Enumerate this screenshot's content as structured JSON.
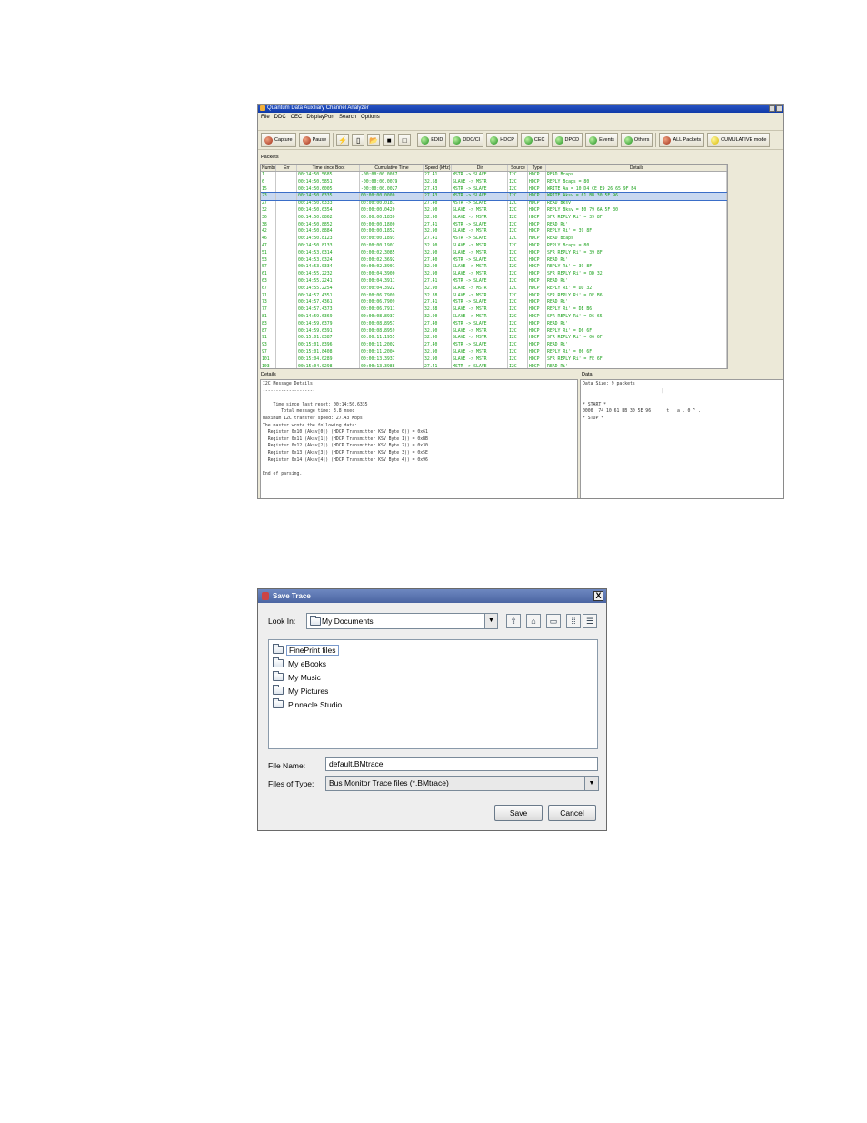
{
  "analyzer": {
    "title": "Quantum Data Auxiliary Channel Analyzer",
    "menu": [
      "File",
      "DDC",
      "CEC",
      "DisplayPort",
      "Search",
      "Options"
    ],
    "toolbar": {
      "capture": "Capture",
      "pause": "Pause",
      "edid": "EDID",
      "ddcci": "DDC/CI",
      "hdcp": "HDCP",
      "cec": "CEC",
      "dpcd": "DPCD",
      "events": "Events",
      "others": "Others",
      "all_packets": "ALL Packets",
      "cumulative": "CUMULATIVE mode"
    },
    "packets_label": "Packets",
    "columns": [
      "Number",
      "Err",
      "Time since Boot",
      "Cumulative Time",
      "Speed (kHz)",
      "Dir",
      "Source",
      "Type",
      "Details"
    ],
    "rows": [
      [
        "1",
        "",
        "00:14:50.5685",
        "-00:00:00.0087",
        "27.41",
        "MSTR -> SLAVE",
        "I2C",
        "HDCP",
        "READ Bcaps"
      ],
      [
        "6",
        "",
        "00:14:50.5851",
        "-00:00:00.0079",
        "32.68",
        "SLAVE -> MSTR",
        "I2C",
        "HDCP",
        "REPLY Bcaps = 80"
      ],
      [
        "15",
        "",
        "00:14:50.6005",
        "-00:00:00.0027",
        "27.43",
        "MSTR -> SLAVE",
        "I2C",
        "HDCP",
        "WRITE Aa = 10 D4 CE E9 26 65 9F B4"
      ],
      [
        "23",
        "",
        "00:14:50.6335",
        "00:00:00.0000",
        "27.43",
        "MSTR -> SLAVE",
        "I2C",
        "HDCP",
        "WRITE Aksv = 61 BB 30 5E 96"
      ],
      [
        "27",
        "",
        "00:14:50.6333",
        "00:00:00.0181",
        "27.40",
        "MSTR -> SLAVE",
        "I2C",
        "HDCP",
        "READ Bksv"
      ],
      [
        "32",
        "",
        "00:14:50.6354",
        "00:00:00.0420",
        "32.90",
        "SLAVE -> MSTR",
        "I2C",
        "HDCP",
        "REPLY Bksv = E0 79 6A 5F 30"
      ],
      [
        "36",
        "",
        "00:14:50.8862",
        "00:00:00.1830",
        "32.90",
        "SLAVE -> MSTR",
        "I2C",
        "HDCP",
        "SFR REPLY Ri' = 39 8F"
      ],
      [
        "38",
        "",
        "00:14:50.8852",
        "00:00:00.1800",
        "27.41",
        "MSTR -> SLAVE",
        "I2C",
        "HDCP",
        "READ Ri'"
      ],
      [
        "42",
        "",
        "00:14:50.8884",
        "00:00:00.1852",
        "32.90",
        "SLAVE -> MSTR",
        "I2C",
        "HDCP",
        "REPLY Ri' = 39 8F"
      ],
      [
        "46",
        "",
        "00:14:50.8123",
        "00:00:00.1893",
        "27.41",
        "MSTR -> SLAVE",
        "I2C",
        "HDCP",
        "READ Bcaps"
      ],
      [
        "47",
        "",
        "00:14:50.8133",
        "00:00:00.1901",
        "32.90",
        "SLAVE -> MSTR",
        "I2C",
        "HDCP",
        "REPLY Bcaps = 80"
      ],
      [
        "51",
        "",
        "00:14:53.0314",
        "00:00:02.3085",
        "32.90",
        "SLAVE -> MSTR",
        "I2C",
        "HDCP",
        "SFR REPLY Ri' = 39 8F"
      ],
      [
        "53",
        "",
        "00:14:53.0324",
        "00:00:02.3692",
        "27.40",
        "MSTR -> SLAVE",
        "I2C",
        "HDCP",
        "READ Ri'"
      ],
      [
        "57",
        "",
        "00:14:53.0334",
        "00:00:02.3901",
        "32.90",
        "SLAVE -> MSTR",
        "I2C",
        "HDCP",
        "REPLY Ri' = 39 8F"
      ],
      [
        "61",
        "",
        "00:14:55.2232",
        "00:00:04.3900",
        "32.90",
        "SLAVE -> MSTR",
        "I2C",
        "HDCP",
        "SFR REPLY Ri' = DD 32"
      ],
      [
        "63",
        "",
        "00:14:55.2241",
        "00:00:04.3911",
        "27.41",
        "MSTR -> SLAVE",
        "I2C",
        "HDCP",
        "READ Ri'"
      ],
      [
        "67",
        "",
        "00:14:55.2254",
        "00:00:04.3922",
        "32.90",
        "SLAVE -> MSTR",
        "I2C",
        "HDCP",
        "REPLY Ri' = DD 32"
      ],
      [
        "71",
        "",
        "00:14:57.4351",
        "00:00:06.7909",
        "32.88",
        "SLAVE -> MSTR",
        "I2C",
        "HDCP",
        "SFR REPLY Ri' = DE B6"
      ],
      [
        "73",
        "",
        "00:14:57.4361",
        "00:00:06.7909",
        "27.41",
        "MSTR -> SLAVE",
        "I2C",
        "HDCP",
        "READ Ri'"
      ],
      [
        "77",
        "",
        "00:14:57.4373",
        "00:00:06.7911",
        "32.88",
        "SLAVE -> MSTR",
        "I2C",
        "HDCP",
        "REPLY Ri' = DE B6"
      ],
      [
        "81",
        "",
        "00:14:59.6369",
        "00:00:08.8937",
        "32.90",
        "SLAVE -> MSTR",
        "I2C",
        "HDCP",
        "SFR REPLY Ri' = D6 65"
      ],
      [
        "83",
        "",
        "00:14:59.6379",
        "00:00:08.8957",
        "27.40",
        "MSTR -> SLAVE",
        "I2C",
        "HDCP",
        "READ Ri'"
      ],
      [
        "87",
        "",
        "00:14:59.6391",
        "00:00:08.8959",
        "32.90",
        "SLAVE -> MSTR",
        "I2C",
        "HDCP",
        "REPLY Ri' = D6 6F"
      ],
      [
        "91",
        "",
        "00:15:01.8387",
        "00:00:11.1955",
        "32.90",
        "SLAVE -> MSTR",
        "I2C",
        "HDCP",
        "SFR REPLY Ri' = 06 6F"
      ],
      [
        "93",
        "",
        "00:15:01.8396",
        "00:00:11.2002",
        "27.40",
        "MSTR -> SLAVE",
        "I2C",
        "HDCP",
        "READ Ri'"
      ],
      [
        "97",
        "",
        "00:15:01.8408",
        "00:00:11.2004",
        "32.90",
        "SLAVE -> MSTR",
        "I2C",
        "HDCP",
        "REPLY Ri' = 06 6F"
      ],
      [
        "101",
        "",
        "00:15:04.0289",
        "00:00:13.3937",
        "32.90",
        "SLAVE -> MSTR",
        "I2C",
        "HDCP",
        "SFR REPLY Ri' = FE 6F"
      ],
      [
        "103",
        "",
        "00:15:04.0298",
        "00:00:13.3988",
        "27.41",
        "MSTR -> SLAVE",
        "I2C",
        "HDCP",
        "READ Ri'"
      ]
    ],
    "selected_row": 3,
    "details_label": "Details",
    "details_text": "I2C Message Details\n--------------------\n\n    Time since last reset: 00:14:50.6335\n       Total message time: 3.8 msec\nMaximum I2C transfer speed: 27.43 Kbps\nThe master wrote the following data:\n  Register 0x10 (Aksv[0]) (HDCP Transmitter KSV Byte 0)) = 0x61\n  Register 0x11 (Aksv[1]) (HDCP Transmitter KSV Byte 1)) = 0xBB\n  Register 0x12 (Aksv[2]) (HDCP Transmitter KSV Byte 2)) = 0x30\n  Register 0x13 (Aksv[3]) (HDCP Transmitter KSV Byte 3)) = 0x5E\n  Register 0x14 (Aksv[4]) (HDCP Transmitter KSV Byte 4)) = 0x96\n\nEnd of parsing.",
    "data_label": "Data",
    "data_text": "Data Size: 9 packets\n                              |\n\n* START *\n0000  74 10 61 BB 30 5E 96      t . a . 0 ^ .\n* STOP *"
  },
  "dialog": {
    "title": "Save Trace",
    "close": "X",
    "look_in_label": "Look In:",
    "look_in_value": "My Documents",
    "files": [
      "FinePrint files",
      "My eBooks",
      "My Music",
      "My Pictures",
      "Pinnacle Studio"
    ],
    "file_name_label": "File Name:",
    "file_name_value": "default.BMtrace",
    "file_type_label": "Files of Type:",
    "file_type_value": "Bus Monitor Trace files (*.BMtrace)",
    "save": "Save",
    "cancel": "Cancel"
  }
}
